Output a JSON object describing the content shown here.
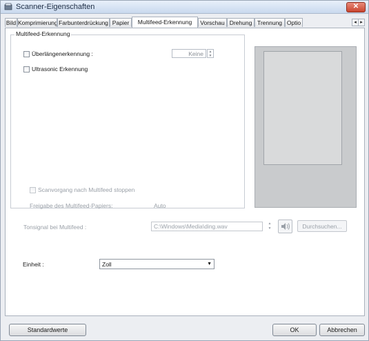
{
  "window": {
    "title": "Scanner-Eigenschaften",
    "close_label": "✕"
  },
  "tabs": [
    {
      "label": "Bild"
    },
    {
      "label": "Komprimierung"
    },
    {
      "label": "Farbunterdrückung"
    },
    {
      "label": "Papier"
    },
    {
      "label": "Multifeed-Erkennung",
      "active": true
    },
    {
      "label": "Vorschau"
    },
    {
      "label": "Drehung"
    },
    {
      "label": "Trennung"
    },
    {
      "label": "Optio"
    }
  ],
  "tab_scroll": {
    "left": "◂",
    "right": "▸"
  },
  "multifeed": {
    "group_label": "Multifeed-Erkennung",
    "length_detection_label": "Überlängenerkennung :",
    "length_detection_checked": false,
    "length_value": "Keine",
    "ultrasonic_label": "Ultrasonic Erkennung",
    "ultrasonic_checked": false,
    "stop_scan_label": "Scanvorgang nach Multifeed stoppen",
    "stop_scan_checked": false,
    "release_label": "Freigabe des Multifeed-Papiers:",
    "release_value": "Auto"
  },
  "sound": {
    "label": "Tonsignal bei Multifeed :",
    "path": "C:\\Windows\\Media\\ding.wav",
    "browse_label": "Durchsuchen..."
  },
  "unit": {
    "label": "Einheit :",
    "value": "Zoll"
  },
  "footer": {
    "defaults_label": "Standardwerte",
    "ok_label": "OK",
    "cancel_label": "Abbrechen"
  },
  "icons": {
    "app": "scanner-icon",
    "speaker": "speaker-icon",
    "dropdown": "chevron-down-icon"
  }
}
